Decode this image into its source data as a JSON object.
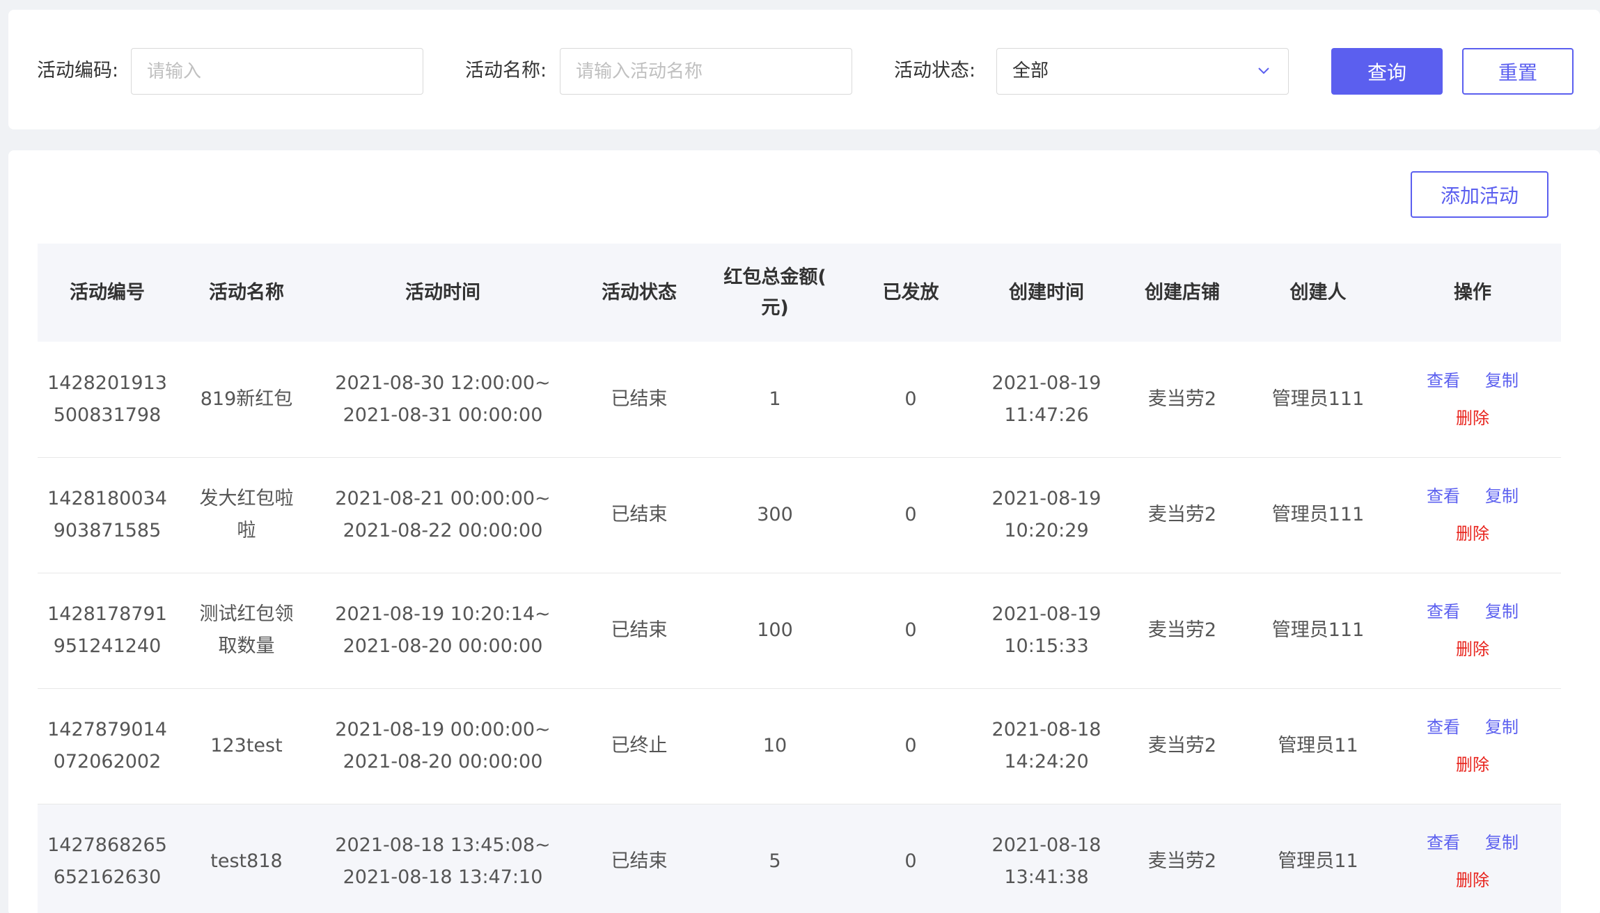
{
  "filters": {
    "code_label": "活动编码:",
    "code_placeholder": "请输入",
    "name_label": "活动名称:",
    "name_placeholder": "请输入活动名称",
    "status_label": "活动状态:",
    "status_value": "全部",
    "query_label": "查询",
    "reset_label": "重置"
  },
  "toolbar": {
    "add_label": "添加活动"
  },
  "table": {
    "headers": [
      "活动编号",
      "活动名称",
      "活动时间",
      "活动状态",
      "红包总金额(元)",
      "已发放",
      "创建时间",
      "创建店铺",
      "创建人",
      "操作"
    ],
    "header_amount_lines": [
      "红包总金额(",
      "元)"
    ],
    "actions": {
      "view": "查看",
      "copy": "复制",
      "delete": "删除"
    },
    "rows": [
      {
        "id_lines": [
          "1428201913",
          "500831798"
        ],
        "name_lines": [
          "819新红包"
        ],
        "time_lines": [
          "2021-08-30 12:00:00~",
          "2021-08-31 00:00:00"
        ],
        "status": "已结束",
        "amount": "1",
        "issued": "0",
        "created_lines": [
          "2021-08-19",
          "11:47:26"
        ],
        "shop": "麦当劳2",
        "creator": "管理员111"
      },
      {
        "id_lines": [
          "1428180034",
          "903871585"
        ],
        "name_lines": [
          "发大红包啦",
          "啦"
        ],
        "time_lines": [
          "2021-08-21 00:00:00~",
          "2021-08-22 00:00:00"
        ],
        "status": "已结束",
        "amount": "300",
        "issued": "0",
        "created_lines": [
          "2021-08-19",
          "10:20:29"
        ],
        "shop": "麦当劳2",
        "creator": "管理员111"
      },
      {
        "id_lines": [
          "1428178791",
          "951241240"
        ],
        "name_lines": [
          "测试红包领",
          "取数量"
        ],
        "time_lines": [
          "2021-08-19 10:20:14~",
          "2021-08-20 00:00:00"
        ],
        "status": "已结束",
        "amount": "100",
        "issued": "0",
        "created_lines": [
          "2021-08-19",
          "10:15:33"
        ],
        "shop": "麦当劳2",
        "creator": "管理员111"
      },
      {
        "id_lines": [
          "1427879014",
          "072062002"
        ],
        "name_lines": [
          "123test"
        ],
        "time_lines": [
          "2021-08-19 00:00:00~",
          "2021-08-20 00:00:00"
        ],
        "status": "已终止",
        "amount": "10",
        "issued": "0",
        "created_lines": [
          "2021-08-18",
          "14:24:20"
        ],
        "shop": "麦当劳2",
        "creator": "管理员11"
      },
      {
        "id_lines": [
          "1427868265",
          "652162630"
        ],
        "name_lines": [
          "test818"
        ],
        "time_lines": [
          "2021-08-18 13:45:08~",
          "2021-08-18 13:47:10"
        ],
        "status": "已结束",
        "amount": "5",
        "issued": "0",
        "created_lines": [
          "2021-08-18",
          "13:41:38"
        ],
        "shop": "麦当劳2",
        "creator": "管理员11"
      }
    ]
  },
  "colors": {
    "primary": "#5b5fef",
    "danger": "#e8231c",
    "header_bg": "#f5f6fa"
  },
  "icons": {
    "status_dropdown": "chevron-down-icon"
  }
}
